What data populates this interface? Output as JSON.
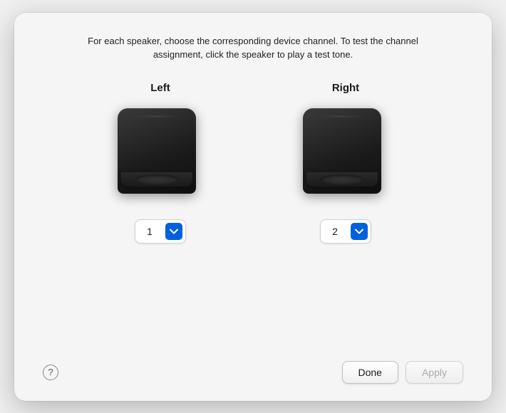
{
  "dialog": {
    "description": "For each speaker, choose the corresponding device channel. To test the channel assignment, click the speaker to play a test tone.",
    "speakers": [
      {
        "id": "left",
        "label": "Left",
        "channel_value": "1"
      },
      {
        "id": "right",
        "label": "Right",
        "channel_value": "2"
      }
    ],
    "footer": {
      "help_label": "?",
      "done_label": "Done",
      "apply_label": "Apply"
    }
  }
}
